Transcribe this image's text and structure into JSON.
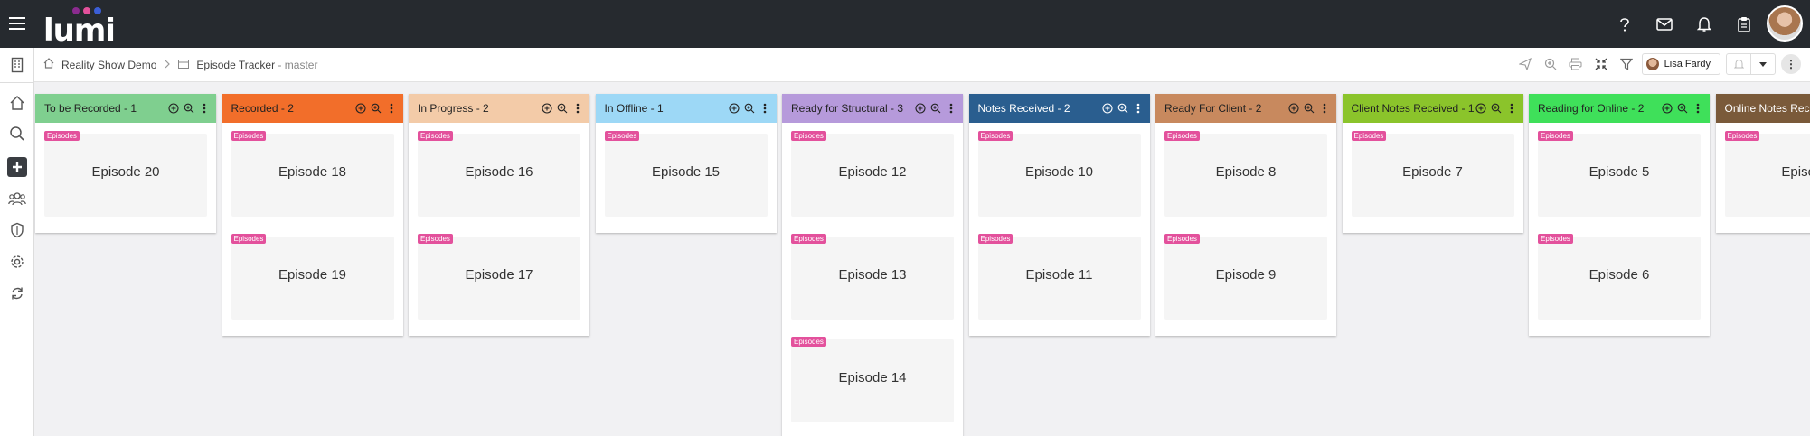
{
  "app": {
    "logo_text": "lumi"
  },
  "topbar": {
    "icons": [
      "help-icon",
      "mail-icon",
      "bell-icon",
      "clipboard-icon"
    ]
  },
  "breadcrumb": {
    "home": "Reality Show Demo",
    "page": "Episode Tracker",
    "branch": "- master"
  },
  "toolbar": {
    "user_name": "Lisa Fardy"
  },
  "tag_label": "Episodes",
  "columns": [
    {
      "title": "To be Recorded - 1",
      "color": "#7fcf8f",
      "cards": [
        "Episode 20"
      ]
    },
    {
      "title": "Recorded - 2",
      "color": "#f26e2a",
      "cards": [
        "Episode 18",
        "Episode 19"
      ]
    },
    {
      "title": "In Progress - 2",
      "color": "#f3cba8",
      "cards": [
        "Episode 16",
        "Episode 17"
      ]
    },
    {
      "title": "In Offline - 1",
      "color": "#9dd8f6",
      "cards": [
        "Episode 15"
      ]
    },
    {
      "title": "Ready for Structural - 3",
      "color": "#b69adb",
      "cards": [
        "Episode 12",
        "Episode 13",
        "Episode 14"
      ]
    },
    {
      "title": "Notes Received - 2",
      "color": "#2a5e8f",
      "text_color": "#ffffff",
      "cards": [
        "Episode 10",
        "Episode 11"
      ]
    },
    {
      "title": "Ready For Client - 2",
      "color": "#c8895e",
      "cards": [
        "Episode 8",
        "Episode 9"
      ]
    },
    {
      "title": "Client Notes Received - 1",
      "color": "#8bc42b",
      "cards": [
        "Episode 7"
      ]
    },
    {
      "title": "Reading for Online - 2",
      "color": "#3fe05a",
      "cards": [
        "Episode 5",
        "Episode 6"
      ]
    },
    {
      "title": "Online Notes Received",
      "color": "#7a5a3a",
      "text_color": "#ffffff",
      "cards": [
        "Episode"
      ]
    }
  ]
}
